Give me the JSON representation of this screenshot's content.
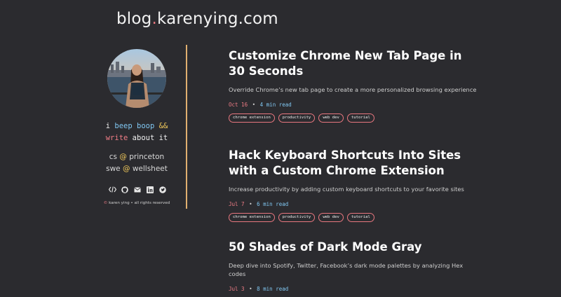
{
  "site": {
    "title_main": "blog",
    "title_dot": ".",
    "title_rest": "karenying.com"
  },
  "sidebar": {
    "tagline": {
      "w1": "i",
      "w2": "beep",
      "w3": "boop",
      "w4": "&&",
      "w5": "write",
      "w6": "about",
      "w7": "it"
    },
    "roles": [
      {
        "prefix": "cs",
        "at": "@",
        "org": "princeton"
      },
      {
        "prefix": "swe",
        "at": "@",
        "org": "wellsheet"
      }
    ],
    "social_icons": [
      "code-icon",
      "github-icon",
      "email-icon",
      "linkedin-icon",
      "twitter-icon"
    ],
    "copyright": {
      "symbol": "©",
      "text": "karen ying • all rights reserved"
    }
  },
  "posts": [
    {
      "title": "Customize Chrome New Tab Page in 30 Seconds",
      "description": "Override Chrome’s new tab page to create a more personalized browsing experience",
      "date": "Oct 16",
      "bullet": "•",
      "read_time": "4 min read",
      "tags": [
        "chrome extension",
        "productivity",
        "web dev",
        "tutorial"
      ]
    },
    {
      "title": "Hack Keyboard Shortcuts Into Sites with a Custom Chrome Extension",
      "description": "Increase productivity by adding custom keyboard shortcuts to your favorite sites",
      "date": "Jul 7",
      "bullet": "•",
      "read_time": "6 min read",
      "tags": [
        "chrome extension",
        "productivity",
        "web dev",
        "tutorial"
      ]
    },
    {
      "title": "50 Shades of Dark Mode Gray",
      "description": "Deep dive into Spotify, Twitter, Facebook’s dark mode palettes by analyzing Hex codes",
      "date": "Jul 3",
      "bullet": "•",
      "read_time": "8 min read",
      "tags": []
    }
  ],
  "colors": {
    "background": "#2b2b2f",
    "accent_red": "#f07d86",
    "accent_blue": "#80c7f2",
    "accent_yellow": "#f0c85a",
    "divider": "#e0b070"
  }
}
